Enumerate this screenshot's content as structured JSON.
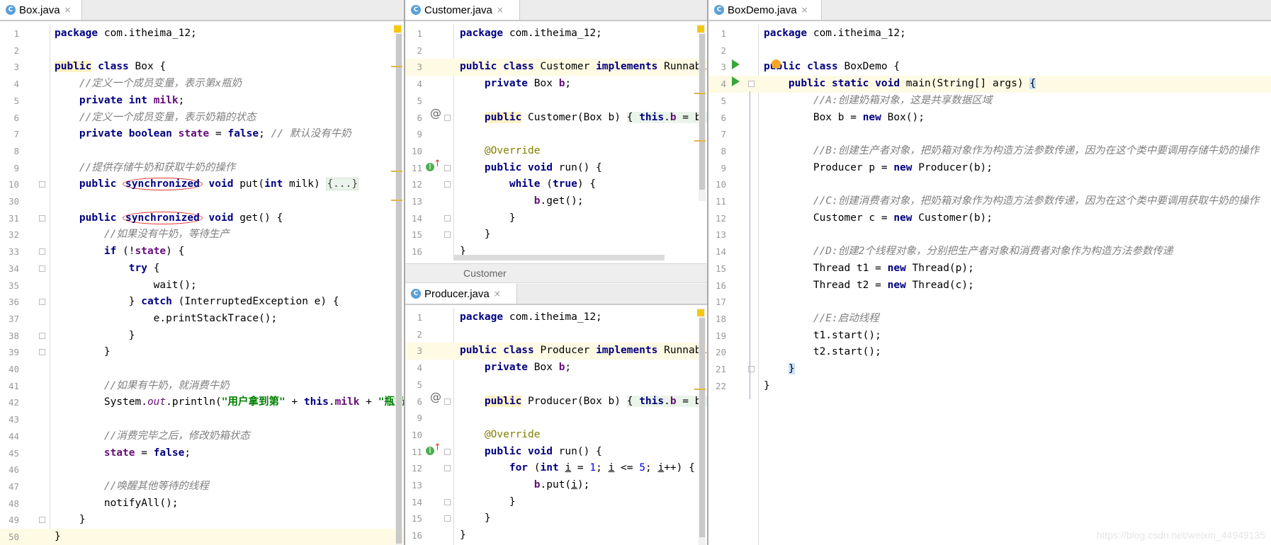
{
  "watermark": "https://blog.csdn.net/weixin_44949135",
  "icons": {
    "class_badge": "C"
  },
  "panes": {
    "box": {
      "tab": {
        "label": "Box.java",
        "close": "×"
      },
      "lines": [
        {
          "n": "1",
          "code": "<span class='kw'>package</span> com.itheima_12;"
        },
        {
          "n": "2",
          "code": ""
        },
        {
          "n": "3",
          "code": "<span class='kw' style='background:#fff2c4'>public</span> <span class='kw'>class</span> Box {"
        },
        {
          "n": "4",
          "code": "    <span class='cm'>//定义一个成员变量，表示第x瓶奶</span>"
        },
        {
          "n": "5",
          "code": "    <span class='kw'>private int</span> <span class='fd'>milk</span>;"
        },
        {
          "n": "6",
          "code": "    <span class='cm'>//定义一个成员变量，表示奶箱的状态</span>"
        },
        {
          "n": "7",
          "code": "    <span class='kw'>private boolean</span> <span class='fd'>state</span> = <span class='kw'>false</span>; <span class='cm'>// 默认没有牛奶</span>"
        },
        {
          "n": "8",
          "code": ""
        },
        {
          "n": "9",
          "code": "    <span class='cm'>//提供存储牛奶和获取牛奶的操作</span>"
        },
        {
          "n": "10",
          "code": "    <span class='kw'>public</span> <span class='kw circle'>synchronized</span> <span class='kw'>void</span> put(<span class='kw'>int</span> milk) <span class='fold-region'>{...}</span>"
        },
        {
          "n": "30",
          "code": ""
        },
        {
          "n": "31",
          "code": "    <span class='kw'>public</span> <span class='kw circle'>synchronized</span> <span class='kw'>void</span> get() {"
        },
        {
          "n": "32",
          "code": "        <span class='cm'>//如果没有牛奶，等待生产</span>"
        },
        {
          "n": "33",
          "code": "        <span class='kw'>if</span> (!<span class='fd'>state</span>) {"
        },
        {
          "n": "34",
          "code": "            <span class='kw'>try</span> {"
        },
        {
          "n": "35",
          "code": "                wait();"
        },
        {
          "n": "36",
          "code": "            } <span class='kw'>catch</span> (InterruptedException e) {"
        },
        {
          "n": "37",
          "code": "                e.printStackTrace();"
        },
        {
          "n": "38",
          "code": "            }"
        },
        {
          "n": "39",
          "code": "        }"
        },
        {
          "n": "40",
          "code": ""
        },
        {
          "n": "41",
          "code": "        <span class='cm'>//如果有牛奶，就消费牛奶</span>"
        },
        {
          "n": "42",
          "code": "        System.<span class='sf'>out</span>.println(<span class='st'>\"用户拿到第\"</span> + <span class='kw'>this</span>.<span class='fd'>milk</span> + <span class='st'>\"瓶奶\"</span>);"
        },
        {
          "n": "43",
          "code": ""
        },
        {
          "n": "44",
          "code": "        <span class='cm'>//消费完毕之后，修改奶箱状态</span>"
        },
        {
          "n": "45",
          "code": "        <span class='fd'>state</span> = <span class='kw'>false</span>;"
        },
        {
          "n": "46",
          "code": ""
        },
        {
          "n": "47",
          "code": "        <span class='cm'>//唤醒其他等待的线程</span>"
        },
        {
          "n": "48",
          "code": "        notifyAll();"
        },
        {
          "n": "49",
          "code": "    }"
        },
        {
          "n": "50",
          "code": "}"
        }
      ]
    },
    "customer": {
      "tab": {
        "label": "Customer.java",
        "close": "×"
      },
      "breadcrumb": "Customer",
      "lines": [
        {
          "n": "1",
          "code": "<span class='kw'>package</span> com.itheima_12;"
        },
        {
          "n": "2",
          "code": ""
        },
        {
          "n": "3",
          "code": "<span class='kw'>public class</span> Customer <span class='kw'>implements</span> Runnable {"
        },
        {
          "n": "4",
          "code": "    <span class='kw'>private</span> Box <span class='fd'>b</span>;"
        },
        {
          "n": "5",
          "code": ""
        },
        {
          "n": "6",
          "code": "    <span class='kw' style='background:#fff2c4'>public</span> Customer(Box b) <span style='background:#eaf4ea'>{ <span class='kw'>this</span>.<span class='fd'>b</span> = b; }</span>"
        },
        {
          "n": "9",
          "code": ""
        },
        {
          "n": "10",
          "code": "    <span class='an'>@Override</span>"
        },
        {
          "n": "11",
          "code": "    <span class='kw'>public void</span> run() {"
        },
        {
          "n": "12",
          "code": "        <span class='kw'>while</span> (<span class='kw'>true</span>) {"
        },
        {
          "n": "13",
          "code": "            <span class='fd'>b</span>.get();"
        },
        {
          "n": "14",
          "code": "        }"
        },
        {
          "n": "15",
          "code": "    }"
        },
        {
          "n": "16",
          "code": "}"
        }
      ]
    },
    "producer": {
      "tab": {
        "label": "Producer.java",
        "close": "×"
      },
      "lines": [
        {
          "n": "1",
          "code": "<span class='kw'>package</span> com.itheima_12;"
        },
        {
          "n": "2",
          "code": ""
        },
        {
          "n": "3",
          "code": "<span class='kw'>public class</span> Producer <span class='kw'>implements</span> Runnable {"
        },
        {
          "n": "4",
          "code": "    <span class='kw'>private</span> Box <span class='fd'>b</span>;"
        },
        {
          "n": "5",
          "code": ""
        },
        {
          "n": "6",
          "code": "    <span class='kw' style='background:#fff2c4'>public</span> Producer(Box b) <span style='background:#eaf4ea'>{ <span class='kw'>this</span>.<span class='fd'>b</span> = b; }</span>"
        },
        {
          "n": "9",
          "code": ""
        },
        {
          "n": "10",
          "code": "    <span class='an'>@Override</span>"
        },
        {
          "n": "11",
          "code": "    <span class='kw'>public void</span> run() {"
        },
        {
          "n": "12",
          "code": "        <span class='kw'>for</span> (<span class='kw'>int</span> <u>i</u> = <span class='num'>1</span>; <u>i</u> &lt;= <span class='num'>5</span>; <u>i</u>++) {"
        },
        {
          "n": "13",
          "code": "            <span class='fd'>b</span>.put(<u>i</u>);"
        },
        {
          "n": "14",
          "code": "        }"
        },
        {
          "n": "15",
          "code": "    }"
        },
        {
          "n": "16",
          "code": "}"
        }
      ]
    },
    "boxdemo": {
      "tab": {
        "label": "BoxDemo.java",
        "close": "×"
      },
      "lines": [
        {
          "n": "1",
          "code": "<span class='kw'>package</span> com.itheima_12;"
        },
        {
          "n": "2",
          "code": ""
        },
        {
          "n": "3",
          "code": "<span class='kw'>public class</span> BoxDemo {"
        },
        {
          "n": "4",
          "code": "    <span class='kw'>public static void</span> main(String[] args) <span style='background:#c8e1ff'>{</span>"
        },
        {
          "n": "5",
          "code": "        <span class='cm'>//A:创建奶箱对象，这是共享数据区域</span>"
        },
        {
          "n": "6",
          "code": "        Box b = <span class='kw'>new</span> Box();"
        },
        {
          "n": "7",
          "code": ""
        },
        {
          "n": "8",
          "code": "        <span class='cm'>//B:创建生产者对象，把奶箱对象作为构造方法参数传递，因为在这个类中要调用存储牛奶的操作</span>"
        },
        {
          "n": "9",
          "code": "        Producer p = <span class='kw'>new</span> Producer(b);"
        },
        {
          "n": "10",
          "code": ""
        },
        {
          "n": "11",
          "code": "        <span class='cm'>//C:创建消费者对象，把奶箱对象作为构造方法参数传递，因为在这个类中要调用获取牛奶的操作</span>"
        },
        {
          "n": "12",
          "code": "        Customer c = <span class='kw'>new</span> Customer(b);"
        },
        {
          "n": "13",
          "code": ""
        },
        {
          "n": "14",
          "code": "        <span class='cm'>//D:创建2个线程对象，分别把生产者对象和消费者对象作为构造方法参数传递</span>"
        },
        {
          "n": "15",
          "code": "        Thread t1 = <span class='kw'>new</span> Thread(p);"
        },
        {
          "n": "16",
          "code": "        Thread t2 = <span class='kw'>new</span> Thread(c);"
        },
        {
          "n": "17",
          "code": ""
        },
        {
          "n": "18",
          "code": "        <span class='cm'>//E:启动线程</span>"
        },
        {
          "n": "19",
          "code": "        t1.start();"
        },
        {
          "n": "20",
          "code": "        t2.start();"
        },
        {
          "n": "21",
          "code": "    <span style='background:#c8e1ff'>}</span>"
        },
        {
          "n": "22",
          "code": "}"
        }
      ]
    }
  }
}
